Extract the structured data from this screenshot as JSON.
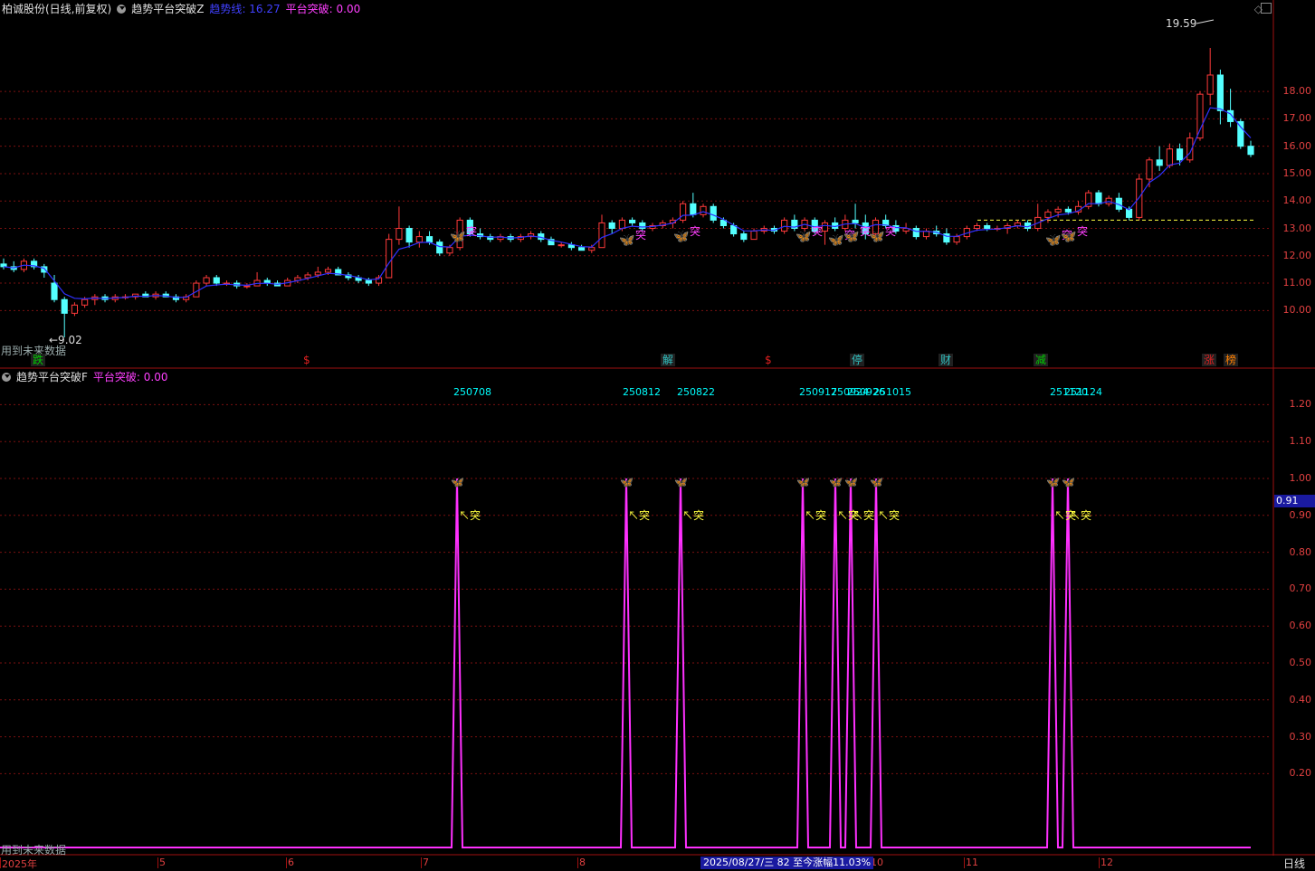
{
  "header": {
    "stock_name": "柏诚股份(日线,前复权)",
    "indicator_name": "趋势平台突破Z",
    "trend_line_label": "趋势线",
    "trend_line_value": "16.27",
    "platform_label": "平台突破",
    "platform_value": "0.00"
  },
  "sub_header": {
    "indicator_name": "趋势平台突破F",
    "platform_label": "平台突破",
    "platform_value": "0.00"
  },
  "future_data_note": "用到未来数据",
  "main_annotations": {
    "high_label": "19.59",
    "low_label": "←9.02",
    "breakout_label": "突",
    "sub_breakout_label": "↖突"
  },
  "event_tags": [
    {
      "text": "跌",
      "color": "#00cc00"
    },
    {
      "text": "$",
      "color": "#e02020"
    },
    {
      "text": "解",
      "color": "#30c0c0"
    },
    {
      "text": "$",
      "color": "#e02020"
    },
    {
      "text": "停",
      "color": "#30c0c0"
    },
    {
      "text": "财",
      "color": "#30c0c0"
    },
    {
      "text": "减",
      "color": "#00cc00"
    },
    {
      "text": "涨",
      "color": "#e02020"
    },
    {
      "text": "榜",
      "color": "#ff8000"
    }
  ],
  "peak_dates": [
    "250708",
    "250812",
    "250822",
    "250917",
    "250924",
    "250926",
    "251015",
    "251120",
    "251124"
  ],
  "price_axis": [
    "18.00",
    "17.00",
    "16.00",
    "15.00",
    "14.00",
    "13.00",
    "12.00",
    "11.00",
    "10.00"
  ],
  "sub_axis": [
    "1.20",
    "1.10",
    "1.00",
    "0.90",
    "0.80",
    "0.70",
    "0.60",
    "0.50",
    "0.40",
    "0.30",
    "0.20"
  ],
  "sub_axis_current": "0.91",
  "x_axis": [
    "2025年",
    "5",
    "6",
    "7",
    "8",
    "10",
    "11",
    "12"
  ],
  "status_bar": "2025/08/27/三 82 至今涨幅11.03%",
  "period_label": "日线",
  "colors": {
    "up": "#ff3a3a",
    "down": "#54ffff",
    "trend": "#3030ff",
    "signal": "#ff30ff",
    "grid": "#7a1010",
    "platform": "#ffff40"
  },
  "chart_data": [
    {
      "type": "candlestick",
      "title": "柏诚股份(日线,前复权)",
      "ylim": [
        9.0,
        19.8
      ],
      "series": [
        {
          "name": "趋势线",
          "last_value": 16.27
        }
      ],
      "annotations": {
        "max": 19.59,
        "min": 9.02
      },
      "ohlc_sample": [
        {
          "o": 11.7,
          "h": 11.9,
          "l": 11.5,
          "c": 11.6
        },
        {
          "o": 11.6,
          "h": 11.8,
          "l": 11.4,
          "c": 11.5
        },
        {
          "o": 11.5,
          "h": 11.9,
          "l": 11.4,
          "c": 11.8
        },
        {
          "o": 11.8,
          "h": 11.9,
          "l": 11.5,
          "c": 11.6
        },
        {
          "o": 11.6,
          "h": 11.7,
          "l": 11.2,
          "c": 11.4
        },
        {
          "o": 11.0,
          "h": 11.3,
          "l": 10.3,
          "c": 10.4
        },
        {
          "o": 10.4,
          "h": 10.5,
          "l": 9.02,
          "c": 9.9
        },
        {
          "o": 9.9,
          "h": 10.3,
          "l": 9.8,
          "c": 10.2
        },
        {
          "o": 10.2,
          "h": 10.5,
          "l": 10.1,
          "c": 10.4
        },
        {
          "o": 10.4,
          "h": 10.6,
          "l": 10.2,
          "c": 10.5
        },
        {
          "o": 10.5,
          "h": 10.6,
          "l": 10.3,
          "c": 10.4
        },
        {
          "o": 10.4,
          "h": 10.6,
          "l": 10.3,
          "c": 10.5
        },
        {
          "o": 10.5,
          "h": 10.6,
          "l": 10.4,
          "c": 10.5
        },
        {
          "o": 10.5,
          "h": 10.6,
          "l": 10.4,
          "c": 10.6
        },
        {
          "o": 10.6,
          "h": 10.7,
          "l": 10.5,
          "c": 10.5
        },
        {
          "o": 10.5,
          "h": 10.7,
          "l": 10.4,
          "c": 10.6
        },
        {
          "o": 10.6,
          "h": 10.7,
          "l": 10.5,
          "c": 10.5
        },
        {
          "o": 10.5,
          "h": 10.6,
          "l": 10.3,
          "c": 10.4
        },
        {
          "o": 10.4,
          "h": 10.6,
          "l": 10.3,
          "c": 10.5
        },
        {
          "o": 10.5,
          "h": 11.1,
          "l": 10.5,
          "c": 11.0
        },
        {
          "o": 11.0,
          "h": 11.3,
          "l": 10.9,
          "c": 11.2
        },
        {
          "o": 11.2,
          "h": 11.3,
          "l": 10.9,
          "c": 11.0
        },
        {
          "o": 11.0,
          "h": 11.1,
          "l": 10.9,
          "c": 11.0
        },
        {
          "o": 11.0,
          "h": 11.1,
          "l": 10.8,
          "c": 10.9
        },
        {
          "o": 10.9,
          "h": 11.0,
          "l": 10.8,
          "c": 10.9
        },
        {
          "o": 10.9,
          "h": 11.4,
          "l": 10.9,
          "c": 11.1
        },
        {
          "o": 11.1,
          "h": 11.2,
          "l": 10.9,
          "c": 11.0
        },
        {
          "o": 11.0,
          "h": 11.1,
          "l": 10.9,
          "c": 10.9
        },
        {
          "o": 10.9,
          "h": 11.2,
          "l": 10.9,
          "c": 11.1
        },
        {
          "o": 11.1,
          "h": 11.3,
          "l": 11.0,
          "c": 11.2
        },
        {
          "o": 11.2,
          "h": 11.4,
          "l": 11.1,
          "c": 11.3
        },
        {
          "o": 11.3,
          "h": 11.6,
          "l": 11.2,
          "c": 11.4
        },
        {
          "o": 11.4,
          "h": 11.6,
          "l": 11.3,
          "c": 11.5
        },
        {
          "o": 11.5,
          "h": 11.6,
          "l": 11.3,
          "c": 11.3
        },
        {
          "o": 11.3,
          "h": 11.4,
          "l": 11.1,
          "c": 11.2
        },
        {
          "o": 11.2,
          "h": 11.3,
          "l": 11.0,
          "c": 11.1
        },
        {
          "o": 11.1,
          "h": 11.2,
          "l": 10.9,
          "c": 11.0
        },
        {
          "o": 11.0,
          "h": 11.3,
          "l": 10.9,
          "c": 11.2
        },
        {
          "o": 11.2,
          "h": 12.8,
          "l": 11.2,
          "c": 12.6
        },
        {
          "o": 12.6,
          "h": 13.8,
          "l": 12.4,
          "c": 13.0
        },
        {
          "o": 13.0,
          "h": 13.1,
          "l": 12.3,
          "c": 12.5
        },
        {
          "o": 12.5,
          "h": 12.9,
          "l": 12.3,
          "c": 12.7
        },
        {
          "o": 12.7,
          "h": 12.9,
          "l": 12.4,
          "c": 12.5
        },
        {
          "o": 12.5,
          "h": 12.6,
          "l": 12.0,
          "c": 12.1
        },
        {
          "o": 12.1,
          "h": 12.4,
          "l": 12.0,
          "c": 12.3
        },
        {
          "o": 12.3,
          "h": 13.4,
          "l": 12.2,
          "c": 13.3
        },
        {
          "o": 13.3,
          "h": 13.4,
          "l": 12.7,
          "c": 12.8
        },
        {
          "o": 12.8,
          "h": 13.0,
          "l": 12.6,
          "c": 12.7
        },
        {
          "o": 12.7,
          "h": 12.8,
          "l": 12.5,
          "c": 12.6
        },
        {
          "o": 12.6,
          "h": 12.8,
          "l": 12.5,
          "c": 12.7
        },
        {
          "o": 12.7,
          "h": 12.8,
          "l": 12.5,
          "c": 12.6
        },
        {
          "o": 12.6,
          "h": 12.8,
          "l": 12.5,
          "c": 12.7
        },
        {
          "o": 12.7,
          "h": 12.9,
          "l": 12.6,
          "c": 12.8
        },
        {
          "o": 12.8,
          "h": 12.9,
          "l": 12.5,
          "c": 12.6
        },
        {
          "o": 12.6,
          "h": 12.7,
          "l": 12.4,
          "c": 12.4
        },
        {
          "o": 12.4,
          "h": 12.5,
          "l": 12.3,
          "c": 12.4
        },
        {
          "o": 12.4,
          "h": 12.5,
          "l": 12.2,
          "c": 12.3
        },
        {
          "o": 12.3,
          "h": 12.4,
          "l": 12.2,
          "c": 12.2
        },
        {
          "o": 12.2,
          "h": 12.4,
          "l": 12.1,
          "c": 12.3
        },
        {
          "o": 12.3,
          "h": 13.5,
          "l": 12.3,
          "c": 13.2
        },
        {
          "o": 13.2,
          "h": 13.3,
          "l": 12.8,
          "c": 13.0
        },
        {
          "o": 13.0,
          "h": 13.4,
          "l": 12.9,
          "c": 13.3
        },
        {
          "o": 13.3,
          "h": 13.4,
          "l": 13.1,
          "c": 13.2
        },
        {
          "o": 13.2,
          "h": 13.3,
          "l": 12.9,
          "c": 13.0
        },
        {
          "o": 13.0,
          "h": 13.2,
          "l": 12.9,
          "c": 13.1
        },
        {
          "o": 13.1,
          "h": 13.3,
          "l": 13.0,
          "c": 13.2
        },
        {
          "o": 13.2,
          "h": 13.4,
          "l": 13.0,
          "c": 13.3
        },
        {
          "o": 13.3,
          "h": 14.0,
          "l": 13.2,
          "c": 13.9
        },
        {
          "o": 13.9,
          "h": 14.3,
          "l": 13.4,
          "c": 13.5
        },
        {
          "o": 13.5,
          "h": 13.9,
          "l": 13.4,
          "c": 13.8
        },
        {
          "o": 13.8,
          "h": 13.9,
          "l": 13.2,
          "c": 13.3
        },
        {
          "o": 13.3,
          "h": 13.4,
          "l": 13.0,
          "c": 13.1
        },
        {
          "o": 13.1,
          "h": 13.2,
          "l": 12.7,
          "c": 12.8
        },
        {
          "o": 12.8,
          "h": 12.9,
          "l": 12.5,
          "c": 12.6
        },
        {
          "o": 12.6,
          "h": 13.0,
          "l": 12.6,
          "c": 12.9
        },
        {
          "o": 12.9,
          "h": 13.1,
          "l": 12.8,
          "c": 13.0
        },
        {
          "o": 13.0,
          "h": 13.1,
          "l": 12.8,
          "c": 12.9
        },
        {
          "o": 12.9,
          "h": 13.4,
          "l": 12.8,
          "c": 13.3
        },
        {
          "o": 13.3,
          "h": 13.5,
          "l": 12.9,
          "c": 13.0
        },
        {
          "o": 13.0,
          "h": 13.4,
          "l": 12.9,
          "c": 13.3
        },
        {
          "o": 13.3,
          "h": 13.4,
          "l": 12.8,
          "c": 12.9
        },
        {
          "o": 12.9,
          "h": 13.3,
          "l": 12.4,
          "c": 13.2
        },
        {
          "o": 13.2,
          "h": 13.4,
          "l": 12.9,
          "c": 13.0
        },
        {
          "o": 13.0,
          "h": 13.5,
          "l": 12.9,
          "c": 13.3
        },
        {
          "o": 13.3,
          "h": 13.9,
          "l": 13.0,
          "c": 13.2
        },
        {
          "o": 13.2,
          "h": 13.5,
          "l": 12.6,
          "c": 12.8
        },
        {
          "o": 12.8,
          "h": 13.4,
          "l": 12.7,
          "c": 13.3
        },
        {
          "o": 13.3,
          "h": 13.5,
          "l": 13.0,
          "c": 13.1
        },
        {
          "o": 13.1,
          "h": 13.3,
          "l": 12.8,
          "c": 12.9
        },
        {
          "o": 12.9,
          "h": 13.2,
          "l": 12.8,
          "c": 13.0
        },
        {
          "o": 13.0,
          "h": 13.1,
          "l": 12.6,
          "c": 12.7
        },
        {
          "o": 12.7,
          "h": 13.0,
          "l": 12.6,
          "c": 12.9
        },
        {
          "o": 12.9,
          "h": 13.1,
          "l": 12.7,
          "c": 12.8
        },
        {
          "o": 12.8,
          "h": 13.0,
          "l": 12.4,
          "c": 12.5
        },
        {
          "o": 12.5,
          "h": 12.8,
          "l": 12.4,
          "c": 12.7
        },
        {
          "o": 12.7,
          "h": 13.1,
          "l": 12.6,
          "c": 13.0
        },
        {
          "o": 13.0,
          "h": 13.2,
          "l": 12.9,
          "c": 13.1
        },
        {
          "o": 13.1,
          "h": 13.2,
          "l": 12.9,
          "c": 13.0
        },
        {
          "o": 13.0,
          "h": 13.1,
          "l": 12.9,
          "c": 13.0
        },
        {
          "o": 13.0,
          "h": 13.2,
          "l": 12.8,
          "c": 13.1
        },
        {
          "o": 13.1,
          "h": 13.3,
          "l": 13.0,
          "c": 13.2
        },
        {
          "o": 13.2,
          "h": 13.3,
          "l": 12.9,
          "c": 13.0
        },
        {
          "o": 13.0,
          "h": 13.9,
          "l": 12.9,
          "c": 13.4
        },
        {
          "o": 13.4,
          "h": 13.7,
          "l": 13.2,
          "c": 13.6
        },
        {
          "o": 13.6,
          "h": 13.8,
          "l": 13.4,
          "c": 13.7
        },
        {
          "o": 13.7,
          "h": 13.8,
          "l": 13.5,
          "c": 13.6
        },
        {
          "o": 13.6,
          "h": 14.0,
          "l": 13.5,
          "c": 13.8
        },
        {
          "o": 13.8,
          "h": 14.4,
          "l": 13.7,
          "c": 14.3
        },
        {
          "o": 14.3,
          "h": 14.4,
          "l": 13.8,
          "c": 13.9
        },
        {
          "o": 13.9,
          "h": 14.2,
          "l": 13.8,
          "c": 14.1
        },
        {
          "o": 14.1,
          "h": 14.3,
          "l": 13.6,
          "c": 13.7
        },
        {
          "o": 13.7,
          "h": 13.8,
          "l": 13.3,
          "c": 13.4
        },
        {
          "o": 13.4,
          "h": 15.0,
          "l": 13.3,
          "c": 14.8
        },
        {
          "o": 14.8,
          "h": 15.6,
          "l": 14.5,
          "c": 15.5
        },
        {
          "o": 15.5,
          "h": 16.0,
          "l": 15.1,
          "c": 15.3
        },
        {
          "o": 15.3,
          "h": 16.1,
          "l": 15.2,
          "c": 15.9
        },
        {
          "o": 15.9,
          "h": 16.1,
          "l": 15.3,
          "c": 15.5
        },
        {
          "o": 15.5,
          "h": 16.5,
          "l": 15.4,
          "c": 16.3
        },
        {
          "o": 16.3,
          "h": 18.0,
          "l": 16.2,
          "c": 17.9
        },
        {
          "o": 17.9,
          "h": 19.59,
          "l": 17.5,
          "c": 18.6
        },
        {
          "o": 18.6,
          "h": 18.8,
          "l": 16.8,
          "c": 17.3
        },
        {
          "o": 17.3,
          "h": 18.1,
          "l": 16.7,
          "c": 16.9
        },
        {
          "o": 16.9,
          "h": 17.0,
          "l": 15.9,
          "c": 16.0
        },
        {
          "o": 16.0,
          "h": 16.2,
          "l": 15.6,
          "c": 15.7
        }
      ]
    },
    {
      "type": "line",
      "title": "趋势平台突破F",
      "ylim": [
        0,
        1.3
      ],
      "series": [
        {
          "name": "平台突破",
          "last_value": 0.0
        }
      ],
      "peaks": [
        {
          "date": "250708",
          "value": 1.0
        },
        {
          "date": "250812",
          "value": 1.0
        },
        {
          "date": "250822",
          "value": 1.0
        },
        {
          "date": "250917",
          "value": 1.0
        },
        {
          "date": "250924",
          "value": 1.0
        },
        {
          "date": "250926",
          "value": 1.0
        },
        {
          "date": "251015",
          "value": 1.0
        },
        {
          "date": "251120",
          "value": 1.0
        },
        {
          "date": "251124",
          "value": 1.0
        }
      ]
    }
  ]
}
